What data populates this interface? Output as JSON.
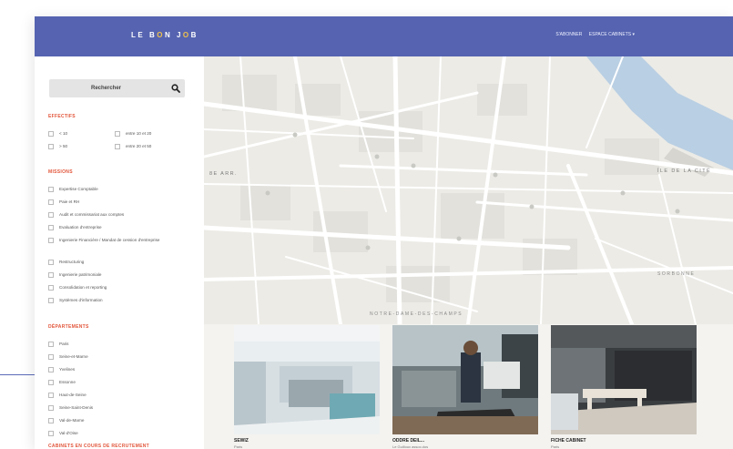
{
  "header": {
    "logo_parts": [
      "LE B",
      "O",
      "N J",
      "O",
      "B"
    ],
    "nav": [
      "S'ABONNER",
      "ESPACE CABINETS ▾"
    ]
  },
  "sidebar": {
    "search_button": "Rechercher",
    "sections": [
      {
        "title": "EFFECTIFS",
        "options": [
          "< 10",
          "entre 10 et 20",
          "> 50",
          "entre 20 et 50"
        ]
      },
      {
        "title": "MISSIONS",
        "options": [
          "Expertise Comptable",
          "Paie et RH",
          "Audit et commissariat aux comptes",
          "Evaluation d'entreprise",
          "Ingenierie Financière / Mandat de cession d'entreprise",
          "Restructuring",
          "Ingenierie patrimoniale",
          "Consolidation et reporting",
          "Systèmes d'information"
        ]
      },
      {
        "title": "DÉPARTEMENTS",
        "options": [
          "Paris",
          "Seine-et-Marne",
          "Yvelines",
          "Essonne",
          "Haut-de-Seine",
          "Seine-Saint-Denis",
          "Val-de-Marne",
          "Val-d'Oise"
        ]
      },
      {
        "title": "CABINETS EN COURS DE RECRUTEMENT",
        "options": []
      }
    ]
  },
  "map": {
    "labels": {
      "arr": "8E ARR.",
      "ile": "ÎLE DE LA CITÉ",
      "sorbonne": "SORBONNE",
      "notre_dame": "NOTRE-DAME-DES-CHAMPS"
    }
  },
  "cards": [
    {
      "title": "SEWIZ",
      "subtitle": "Paris"
    },
    {
      "title": "ODDRE DEIL...",
      "subtitle": "Le Guilloux assoc.dos"
    },
    {
      "title": "FICHE CABINET",
      "subtitle": "Paris"
    }
  ],
  "colors": {
    "header": "#5563b0",
    "accent": "#e2553a",
    "logo_accent": "#f0c24a"
  }
}
